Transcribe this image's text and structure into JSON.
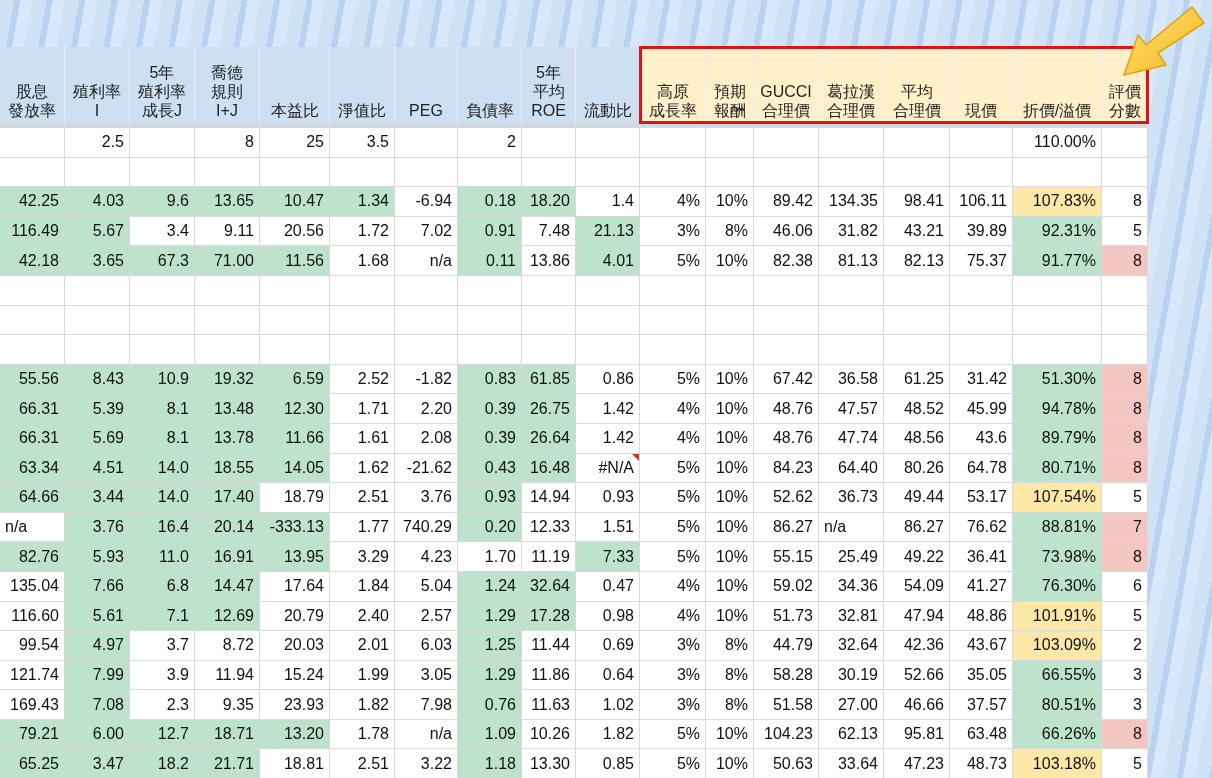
{
  "columns": [
    {
      "label": [
        "股息",
        "發放率"
      ],
      "highlighted": false
    },
    {
      "label": [
        "殖利率",
        "I"
      ],
      "highlighted": false
    },
    {
      "label": [
        "5年",
        "殖利率",
        "成長J"
      ],
      "highlighted": false
    },
    {
      "label": [
        "喬德",
        "規則",
        "I+J"
      ],
      "highlighted": false
    },
    {
      "label": [
        "本益比"
      ],
      "highlighted": false
    },
    {
      "label": [
        "淨值比"
      ],
      "highlighted": false
    },
    {
      "label": [
        "PEG"
      ],
      "highlighted": false
    },
    {
      "label": [
        "負債率"
      ],
      "highlighted": false
    },
    {
      "label": [
        "5年",
        "平均",
        "ROE"
      ],
      "highlighted": false
    },
    {
      "label": [
        "流動比"
      ],
      "highlighted": false
    },
    {
      "label": [
        "高原",
        "成長率"
      ],
      "highlighted": true
    },
    {
      "label": [
        "預期",
        "報酬"
      ],
      "highlighted": true
    },
    {
      "label": [
        "GUCCI",
        "合理價"
      ],
      "highlighted": true
    },
    {
      "label": [
        "葛拉漢",
        "合理價"
      ],
      "highlighted": true
    },
    {
      "label": [
        "平均",
        "合理價"
      ],
      "highlighted": true
    },
    {
      "label": [
        "現價"
      ],
      "highlighted": true
    },
    {
      "label": [
        "折價/溢價"
      ],
      "highlighted": true
    },
    {
      "label": [
        "評價",
        "分數"
      ],
      "highlighted": true
    }
  ],
  "rows": [
    {
      "kind": "data",
      "cells": [
        {},
        {
          "text": "2.5"
        },
        {},
        {
          "text": "8"
        },
        {
          "text": "25"
        },
        {
          "text": "3.5"
        },
        {},
        {
          "text": "2"
        },
        {},
        {},
        {},
        {},
        {},
        {},
        {},
        {},
        {
          "text": "110.00%"
        },
        {}
      ]
    },
    {
      "kind": "empty"
    },
    {
      "kind": "data",
      "cells": [
        {
          "text": "42.25",
          "color": "#bde3cd"
        },
        {
          "text": "4.03",
          "color": "#bde3cd"
        },
        {
          "text": "9.6",
          "color": "#bde3cd"
        },
        {
          "text": "13.65",
          "color": "#bde3cd"
        },
        {
          "text": "10.47",
          "color": "#bde3cd"
        },
        {
          "text": "1.34",
          "color": "#bde3cd"
        },
        {
          "text": "-6.94"
        },
        {
          "text": "0.18",
          "color": "#bde3cd"
        },
        {
          "text": "18.20",
          "color": "#bde3cd"
        },
        {
          "text": "1.4"
        },
        {
          "text": "4%"
        },
        {
          "text": "10%"
        },
        {
          "text": "89.42"
        },
        {
          "text": "134.35"
        },
        {
          "text": "98.41"
        },
        {
          "text": "106.11"
        },
        {
          "text": "107.83%",
          "color": "#fde8a8"
        },
        {
          "text": "8"
        }
      ]
    },
    {
      "kind": "data",
      "cells": [
        {
          "text": "116.49",
          "color": "#bde3cd"
        },
        {
          "text": "5.67",
          "color": "#bde3cd"
        },
        {
          "text": "3.4"
        },
        {
          "text": "9.11"
        },
        {
          "text": "20.56"
        },
        {
          "text": "1.72"
        },
        {
          "text": "7.02"
        },
        {
          "text": "0.91",
          "color": "#bde3cd"
        },
        {
          "text": "7.48"
        },
        {
          "text": "21.13",
          "color": "#bde3cd"
        },
        {
          "text": "3%"
        },
        {
          "text": "8%"
        },
        {
          "text": "46.06"
        },
        {
          "text": "31.82"
        },
        {
          "text": "43.21"
        },
        {
          "text": "39.89"
        },
        {
          "text": "92.31%",
          "color": "#bde3cd"
        },
        {
          "text": "5"
        }
      ]
    },
    {
      "kind": "data",
      "cells": [
        {
          "text": "42.18",
          "color": "#bde3cd"
        },
        {
          "text": "3.65",
          "color": "#bde3cd"
        },
        {
          "text": "67.3",
          "color": "#bde3cd"
        },
        {
          "text": "71.00",
          "color": "#bde3cd"
        },
        {
          "text": "11.56",
          "color": "#bde3cd"
        },
        {
          "text": "1.68"
        },
        {
          "text": "n/a"
        },
        {
          "text": "0.11",
          "color": "#bde3cd"
        },
        {
          "text": "13.86"
        },
        {
          "text": "4.01",
          "color": "#bde3cd"
        },
        {
          "text": "5%"
        },
        {
          "text": "10%"
        },
        {
          "text": "82.38"
        },
        {
          "text": "81.13"
        },
        {
          "text": "82.13"
        },
        {
          "text": "75.37"
        },
        {
          "text": "91.77%",
          "color": "#bde3cd"
        },
        {
          "text": "8",
          "color": "#f3c6c2"
        }
      ]
    },
    {
      "kind": "empty"
    },
    {
      "kind": "empty"
    },
    {
      "kind": "empty"
    },
    {
      "kind": "data",
      "cells": [
        {
          "text": "55.56",
          "color": "#bde3cd"
        },
        {
          "text": "8.43",
          "color": "#bde3cd"
        },
        {
          "text": "10.9",
          "color": "#bde3cd"
        },
        {
          "text": "19.32",
          "color": "#bde3cd"
        },
        {
          "text": "6.59",
          "color": "#bde3cd"
        },
        {
          "text": "2.52"
        },
        {
          "text": "-1.82"
        },
        {
          "text": "0.83",
          "color": "#bde3cd"
        },
        {
          "text": "61.85",
          "color": "#bde3cd"
        },
        {
          "text": "0.86"
        },
        {
          "text": "5%"
        },
        {
          "text": "10%"
        },
        {
          "text": "67.42"
        },
        {
          "text": "36.58"
        },
        {
          "text": "61.25"
        },
        {
          "text": "31.42"
        },
        {
          "text": "51.30%",
          "color": "#bde3cd"
        },
        {
          "text": "8",
          "color": "#f3c6c2"
        }
      ]
    },
    {
      "kind": "data",
      "cells": [
        {
          "text": "66.31",
          "color": "#bde3cd"
        },
        {
          "text": "5.39",
          "color": "#bde3cd"
        },
        {
          "text": "8.1",
          "color": "#bde3cd"
        },
        {
          "text": "13.48",
          "color": "#bde3cd"
        },
        {
          "text": "12.30",
          "color": "#bde3cd"
        },
        {
          "text": "1.71"
        },
        {
          "text": "2.20"
        },
        {
          "text": "0.39",
          "color": "#bde3cd"
        },
        {
          "text": "26.75",
          "color": "#bde3cd"
        },
        {
          "text": "1.42"
        },
        {
          "text": "4%"
        },
        {
          "text": "10%"
        },
        {
          "text": "48.76"
        },
        {
          "text": "47.57"
        },
        {
          "text": "48.52"
        },
        {
          "text": "45.99"
        },
        {
          "text": "94.78%",
          "color": "#bde3cd"
        },
        {
          "text": "8",
          "color": "#f3c6c2"
        }
      ]
    },
    {
      "kind": "data",
      "cells": [
        {
          "text": "66.31",
          "color": "#bde3cd"
        },
        {
          "text": "5.69",
          "color": "#bde3cd"
        },
        {
          "text": "8.1",
          "color": "#bde3cd"
        },
        {
          "text": "13.78",
          "color": "#bde3cd"
        },
        {
          "text": "11.66",
          "color": "#bde3cd"
        },
        {
          "text": "1.61"
        },
        {
          "text": "2.08"
        },
        {
          "text": "0.39",
          "color": "#bde3cd"
        },
        {
          "text": "26.64",
          "color": "#bde3cd"
        },
        {
          "text": "1.42"
        },
        {
          "text": "4%"
        },
        {
          "text": "10%"
        },
        {
          "text": "48.76"
        },
        {
          "text": "47.74"
        },
        {
          "text": "48.56"
        },
        {
          "text": "43.6"
        },
        {
          "text": "89.79%",
          "color": "#bde3cd"
        },
        {
          "text": "8",
          "color": "#f3c6c2"
        }
      ]
    },
    {
      "kind": "data",
      "cells": [
        {
          "text": "63.34",
          "color": "#bde3cd"
        },
        {
          "text": "4.51",
          "color": "#bde3cd"
        },
        {
          "text": "14.0",
          "color": "#bde3cd"
        },
        {
          "text": "18.55",
          "color": "#bde3cd"
        },
        {
          "text": "14.05",
          "color": "#bde3cd"
        },
        {
          "text": "1.62"
        },
        {
          "text": "-21.62"
        },
        {
          "text": "0.43",
          "color": "#bde3cd"
        },
        {
          "text": "16.48",
          "color": "#bde3cd"
        },
        {
          "text": "#N/A",
          "comment": true
        },
        {
          "text": "5%"
        },
        {
          "text": "10%"
        },
        {
          "text": "84.23"
        },
        {
          "text": "64.40"
        },
        {
          "text": "80.26"
        },
        {
          "text": "64.78"
        },
        {
          "text": "80.71%",
          "color": "#bde3cd"
        },
        {
          "text": "8",
          "color": "#f3c6c2"
        }
      ]
    },
    {
      "kind": "data",
      "cells": [
        {
          "text": "64.66",
          "color": "#bde3cd"
        },
        {
          "text": "3.44",
          "color": "#bde3cd"
        },
        {
          "text": "14.0",
          "color": "#bde3cd"
        },
        {
          "text": "17.40",
          "color": "#bde3cd"
        },
        {
          "text": "18.79"
        },
        {
          "text": "2.51"
        },
        {
          "text": "3.76"
        },
        {
          "text": "0.93",
          "color": "#bde3cd"
        },
        {
          "text": "14.94"
        },
        {
          "text": "0.93"
        },
        {
          "text": "5%"
        },
        {
          "text": "10%"
        },
        {
          "text": "52.62"
        },
        {
          "text": "36.73"
        },
        {
          "text": "49.44"
        },
        {
          "text": "53.17"
        },
        {
          "text": "107.54%",
          "color": "#fde8a8"
        },
        {
          "text": "5"
        }
      ]
    },
    {
      "kind": "data",
      "cells": [
        {
          "text": "n/a",
          "left_aligned": true
        },
        {
          "text": "3.76",
          "color": "#bde3cd"
        },
        {
          "text": "16.4",
          "color": "#bde3cd"
        },
        {
          "text": "20.14",
          "color": "#bde3cd"
        },
        {
          "text": "-333.13",
          "color": "#bde3cd"
        },
        {
          "text": "1.77"
        },
        {
          "text": "740.29"
        },
        {
          "text": "0.20",
          "color": "#bde3cd"
        },
        {
          "text": "12.33"
        },
        {
          "text": "1.51"
        },
        {
          "text": "5%"
        },
        {
          "text": "10%"
        },
        {
          "text": "86.27"
        },
        {
          "text": "n/a",
          "left_aligned": true
        },
        {
          "text": "86.27"
        },
        {
          "text": "76.62"
        },
        {
          "text": "88.81%",
          "color": "#bde3cd"
        },
        {
          "text": "7",
          "color": "#f3c6c2"
        }
      ]
    },
    {
      "kind": "data",
      "cells": [
        {
          "text": "82.76",
          "color": "#bde3cd"
        },
        {
          "text": "5.93",
          "color": "#bde3cd"
        },
        {
          "text": "11.0",
          "color": "#bde3cd"
        },
        {
          "text": "16.91",
          "color": "#bde3cd"
        },
        {
          "text": "13.95",
          "color": "#bde3cd"
        },
        {
          "text": "3.29"
        },
        {
          "text": "4.23"
        },
        {
          "text": "1.70"
        },
        {
          "text": "11.19"
        },
        {
          "text": "7.33",
          "color": "#bde3cd"
        },
        {
          "text": "5%"
        },
        {
          "text": "10%"
        },
        {
          "text": "55.15"
        },
        {
          "text": "25.49"
        },
        {
          "text": "49.22"
        },
        {
          "text": "36.41"
        },
        {
          "text": "73.98%",
          "color": "#bde3cd"
        },
        {
          "text": "8",
          "color": "#f3c6c2"
        }
      ]
    },
    {
      "kind": "data",
      "cells": [
        {
          "text": "135.04"
        },
        {
          "text": "7.66",
          "color": "#bde3cd"
        },
        {
          "text": "6.8",
          "color": "#bde3cd"
        },
        {
          "text": "14.47",
          "color": "#bde3cd"
        },
        {
          "text": "17.64"
        },
        {
          "text": "1.84"
        },
        {
          "text": "5.04"
        },
        {
          "text": "1.24",
          "color": "#bde3cd"
        },
        {
          "text": "32.64",
          "color": "#bde3cd"
        },
        {
          "text": "0.47"
        },
        {
          "text": "4%"
        },
        {
          "text": "10%"
        },
        {
          "text": "59.02"
        },
        {
          "text": "34.36"
        },
        {
          "text": "54.09"
        },
        {
          "text": "41.27"
        },
        {
          "text": "76.30%",
          "color": "#bde3cd"
        },
        {
          "text": "6"
        }
      ]
    },
    {
      "kind": "data",
      "cells": [
        {
          "text": "116.60"
        },
        {
          "text": "5.61",
          "color": "#bde3cd"
        },
        {
          "text": "7.1",
          "color": "#bde3cd"
        },
        {
          "text": "12.69",
          "color": "#bde3cd"
        },
        {
          "text": "20.79"
        },
        {
          "text": "2.40"
        },
        {
          "text": "2.57"
        },
        {
          "text": "1.29",
          "color": "#bde3cd"
        },
        {
          "text": "17.28",
          "color": "#bde3cd"
        },
        {
          "text": "0.98"
        },
        {
          "text": "4%"
        },
        {
          "text": "10%"
        },
        {
          "text": "51.73"
        },
        {
          "text": "32.81"
        },
        {
          "text": "47.94"
        },
        {
          "text": "48.86"
        },
        {
          "text": "101.91%",
          "color": "#fde8a8"
        },
        {
          "text": "5"
        }
      ]
    },
    {
      "kind": "data",
      "cells": [
        {
          "text": "99.54"
        },
        {
          "text": "4.97",
          "color": "#bde3cd"
        },
        {
          "text": "3.7"
        },
        {
          "text": "8.72"
        },
        {
          "text": "20.03"
        },
        {
          "text": "2.01"
        },
        {
          "text": "6.03"
        },
        {
          "text": "1.25",
          "color": "#bde3cd"
        },
        {
          "text": "11.44"
        },
        {
          "text": "0.69"
        },
        {
          "text": "3%"
        },
        {
          "text": "8%"
        },
        {
          "text": "44.79"
        },
        {
          "text": "32.64"
        },
        {
          "text": "42.36"
        },
        {
          "text": "43.67"
        },
        {
          "text": "103.09%",
          "color": "#fde8a8"
        },
        {
          "text": "2"
        }
      ]
    },
    {
      "kind": "data",
      "cells": [
        {
          "text": "121.74"
        },
        {
          "text": "7.99",
          "color": "#bde3cd"
        },
        {
          "text": "3.9"
        },
        {
          "text": "11.94"
        },
        {
          "text": "15.24"
        },
        {
          "text": "1.99"
        },
        {
          "text": "3.05"
        },
        {
          "text": "1.29",
          "color": "#bde3cd"
        },
        {
          "text": "11.86"
        },
        {
          "text": "0.64"
        },
        {
          "text": "3%"
        },
        {
          "text": "8%"
        },
        {
          "text": "58.28"
        },
        {
          "text": "30.19"
        },
        {
          "text": "52.66"
        },
        {
          "text": "35.05"
        },
        {
          "text": "66.55%",
          "color": "#bde3cd"
        },
        {
          "text": "3"
        }
      ]
    },
    {
      "kind": "data",
      "cells": [
        {
          "text": "169.43"
        },
        {
          "text": "7.08",
          "color": "#bde3cd"
        },
        {
          "text": "2.3"
        },
        {
          "text": "9.35"
        },
        {
          "text": "23.93"
        },
        {
          "text": "1.82"
        },
        {
          "text": "7.98"
        },
        {
          "text": "0.76",
          "color": "#bde3cd"
        },
        {
          "text": "11.63"
        },
        {
          "text": "1.02"
        },
        {
          "text": "3%"
        },
        {
          "text": "8%"
        },
        {
          "text": "51.58"
        },
        {
          "text": "27.00"
        },
        {
          "text": "46.66"
        },
        {
          "text": "37.57"
        },
        {
          "text": "80.51%",
          "color": "#bde3cd"
        },
        {
          "text": "3"
        }
      ]
    },
    {
      "kind": "data",
      "cells": [
        {
          "text": "79.21",
          "color": "#bde3cd"
        },
        {
          "text": "6.00",
          "color": "#bde3cd"
        },
        {
          "text": "12.7",
          "color": "#bde3cd"
        },
        {
          "text": "18.71",
          "color": "#bde3cd"
        },
        {
          "text": "13.20",
          "color": "#bde3cd"
        },
        {
          "text": "1.78"
        },
        {
          "text": "n/a"
        },
        {
          "text": "1.09",
          "color": "#bde3cd"
        },
        {
          "text": "10.26"
        },
        {
          "text": "1.82"
        },
        {
          "text": "5%"
        },
        {
          "text": "10%"
        },
        {
          "text": "104.23"
        },
        {
          "text": "62.13"
        },
        {
          "text": "95.81"
        },
        {
          "text": "63.48"
        },
        {
          "text": "66.26%",
          "color": "#bde3cd"
        },
        {
          "text": "8",
          "color": "#f3c6c2"
        }
      ]
    },
    {
      "kind": "data",
      "cells": [
        {
          "text": "65.25",
          "color": "#bde3cd"
        },
        {
          "text": "3.47",
          "color": "#bde3cd"
        },
        {
          "text": "18.2",
          "color": "#bde3cd"
        },
        {
          "text": "21.71",
          "color": "#bde3cd"
        },
        {
          "text": "18.81"
        },
        {
          "text": "2.51"
        },
        {
          "text": "3.22"
        },
        {
          "text": "1.18",
          "color": "#bde3cd"
        },
        {
          "text": "13.30"
        },
        {
          "text": "0.85"
        },
        {
          "text": "5%"
        },
        {
          "text": "10%"
        },
        {
          "text": "50.63"
        },
        {
          "text": "33.64"
        },
        {
          "text": "47.23"
        },
        {
          "text": "48.73"
        },
        {
          "text": "103.18%",
          "color": "#fde8a8"
        },
        {
          "text": "5"
        }
      ]
    }
  ]
}
